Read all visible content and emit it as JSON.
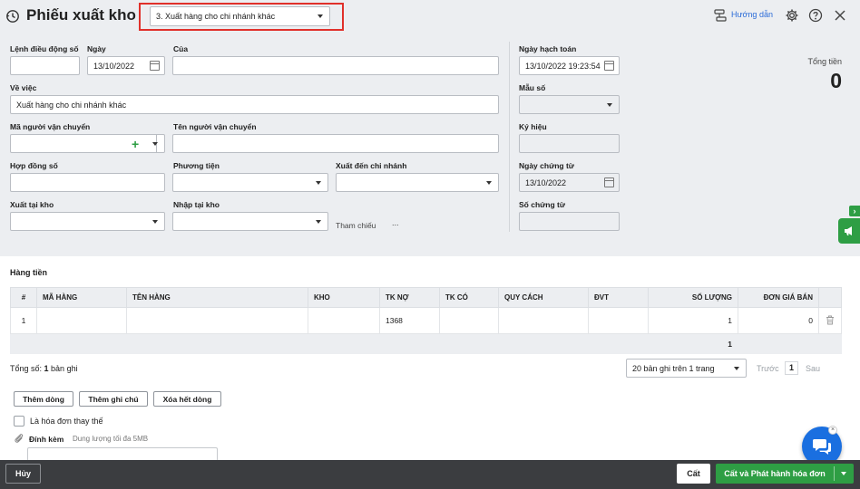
{
  "header": {
    "title": "Phiếu xuất kho",
    "type_select": "3. Xuất hàng cho chi nhánh khác",
    "guide_label": "Hướng dẫn"
  },
  "form": {
    "lenh_dieu_dong": {
      "label": "Lệnh điều động số",
      "value": ""
    },
    "ngay": {
      "label": "Ngày",
      "value": "13/10/2022"
    },
    "cua": {
      "label": "Của",
      "value": ""
    },
    "ve_viec": {
      "label": "Về việc",
      "value": "Xuất hàng cho chi nhánh khác"
    },
    "ma_nguoi_van_chuyen": {
      "label": "Mã người vận chuyển",
      "value": "",
      "add_symbol": "+"
    },
    "ten_nguoi_van_chuyen": {
      "label": "Tên người vận chuyển",
      "value": ""
    },
    "hop_dong_so": {
      "label": "Hợp đồng số",
      "value": ""
    },
    "phuong_tien": {
      "label": "Phương tiện",
      "value": ""
    },
    "xuat_den_chi_nhanh": {
      "label": "Xuất đến chi nhánh",
      "value": ""
    },
    "xuat_tai_kho": {
      "label": "Xuất tại kho",
      "value": ""
    },
    "nhap_tai_kho": {
      "label": "Nhập tại kho",
      "value": ""
    },
    "tham_chieu": {
      "label": "Tham chiếu",
      "more": "..."
    },
    "ngay_hach_toan": {
      "label": "Ngày hạch toán",
      "value": "13/10/2022 19:23:54"
    },
    "mau_so": {
      "label": "Mẫu số",
      "value": ""
    },
    "ky_hieu": {
      "label": "Ký hiệu",
      "value": ""
    },
    "ngay_chung_tu": {
      "label": "Ngày chứng từ",
      "value": "13/10/2022"
    },
    "so_chung_tu": {
      "label": "Số chứng từ",
      "value": ""
    }
  },
  "total": {
    "label": "Tổng tiền",
    "value": "0"
  },
  "section_title": "Hàng tiền",
  "table": {
    "columns": [
      "#",
      "MÃ HÀNG",
      "TÊN HÀNG",
      "KHO",
      "TK NỢ",
      "TK CÓ",
      "QUY CÁCH",
      "ĐVT",
      "SỐ LƯỢNG",
      "ĐƠN GIÁ BÁN"
    ],
    "rows": [
      {
        "no": "1",
        "ma_hang": "",
        "ten_hang": "",
        "kho": "",
        "tk_no": "1368",
        "tk_co": "",
        "quy_cach": "",
        "dvt": "",
        "so_luong": "1",
        "don_gia": "0"
      }
    ],
    "sum_so_luong": "1"
  },
  "paging": {
    "total_prefix": "Tổng số: ",
    "total_count": "1",
    "total_suffix": " bản ghi",
    "per_page": "20 bản ghi trên 1 trang",
    "prev": "Trước",
    "page": "1",
    "next": "Sau"
  },
  "actions": {
    "add_row": "Thêm dòng",
    "add_note": "Thêm ghi chú",
    "delete_all": "Xóa hết dòng"
  },
  "replace_invoice": "Là hóa đơn thay thế",
  "attach": {
    "label": "Đính kèm",
    "hint": "Dung lượng tối đa 5MB"
  },
  "footer": {
    "cancel": "Hủy",
    "save": "Cất",
    "save_issue": "Cất và Phát hành hóa đơn"
  },
  "colors": {
    "accent_green": "#2e9e44",
    "highlight_red": "#e0302a",
    "link_blue": "#2a6bd8"
  }
}
